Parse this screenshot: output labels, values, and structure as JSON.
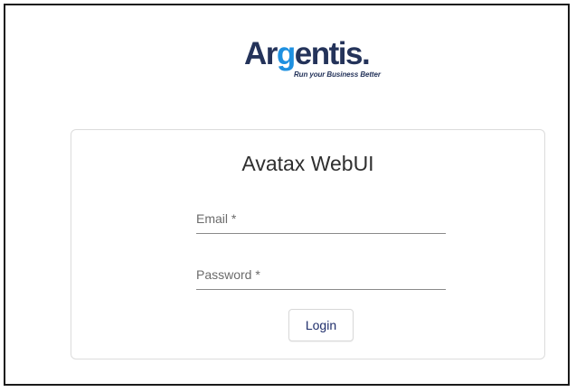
{
  "logo": {
    "brand_part1": "Ar",
    "brand_part2": "g",
    "brand_part3": "entis.",
    "tagline": "Run your Business Better",
    "colors": {
      "dark": "#24335a",
      "accent": "#1e90e0"
    }
  },
  "login": {
    "title": "Avatax WebUI",
    "email_label": "Email *",
    "password_label": "Password *",
    "login_label": "Login",
    "button_color": "#1f2e6b"
  }
}
